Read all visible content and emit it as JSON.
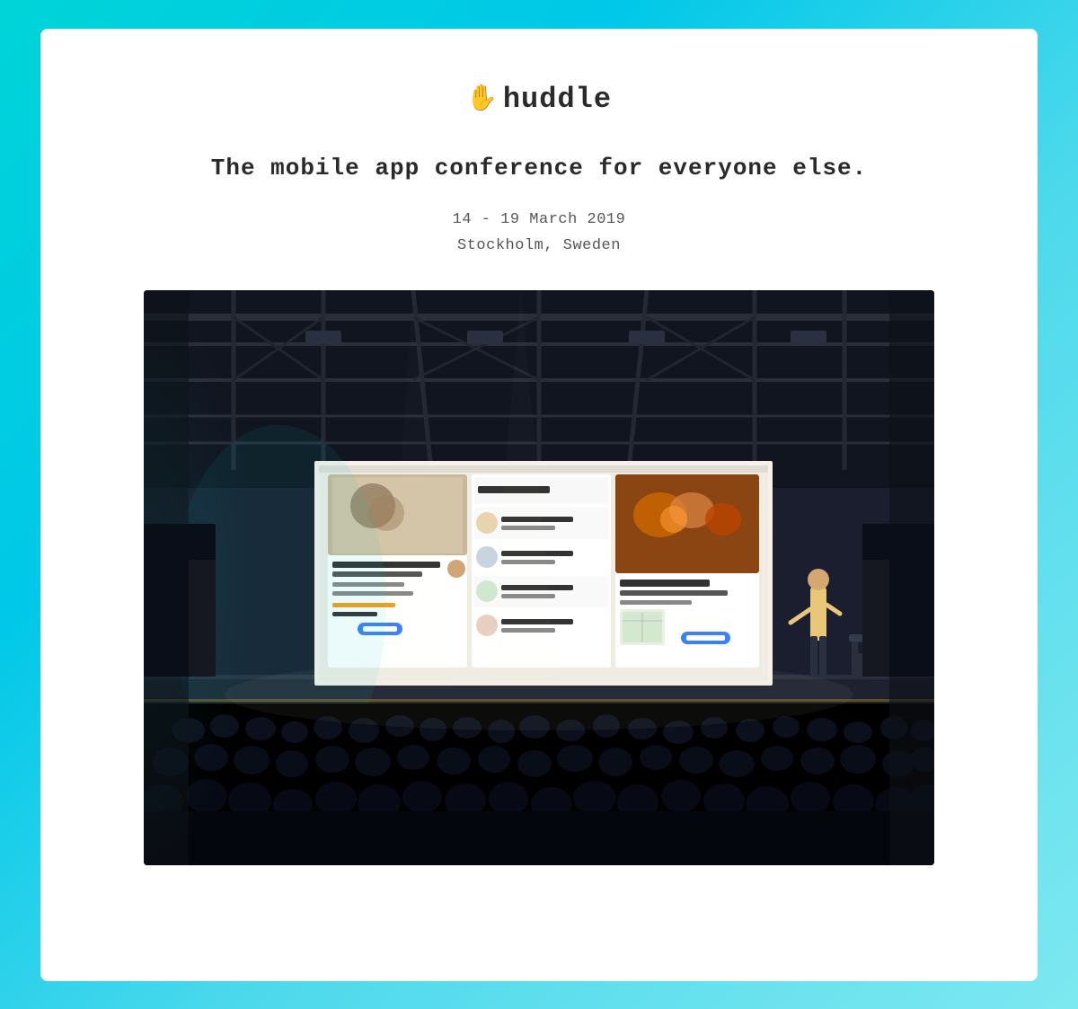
{
  "page": {
    "background_gradient": "linear-gradient(135deg, #00d4d8, #4dd9ec)"
  },
  "logo": {
    "hand_icon": "✋",
    "name": "huddle",
    "full_text": "✋ huddle"
  },
  "hero": {
    "tagline": "The mobile app conference for everyone else.",
    "date": "14 - 19 March 2019",
    "location": "Stockholm, Sweden"
  },
  "image": {
    "alt": "Conference hall with presenter on stage showing mobile app UI on large screen",
    "description": "A large conference hall with audience seated, a presenter standing at a podium on stage with a large projection screen showing mobile app interfaces"
  }
}
